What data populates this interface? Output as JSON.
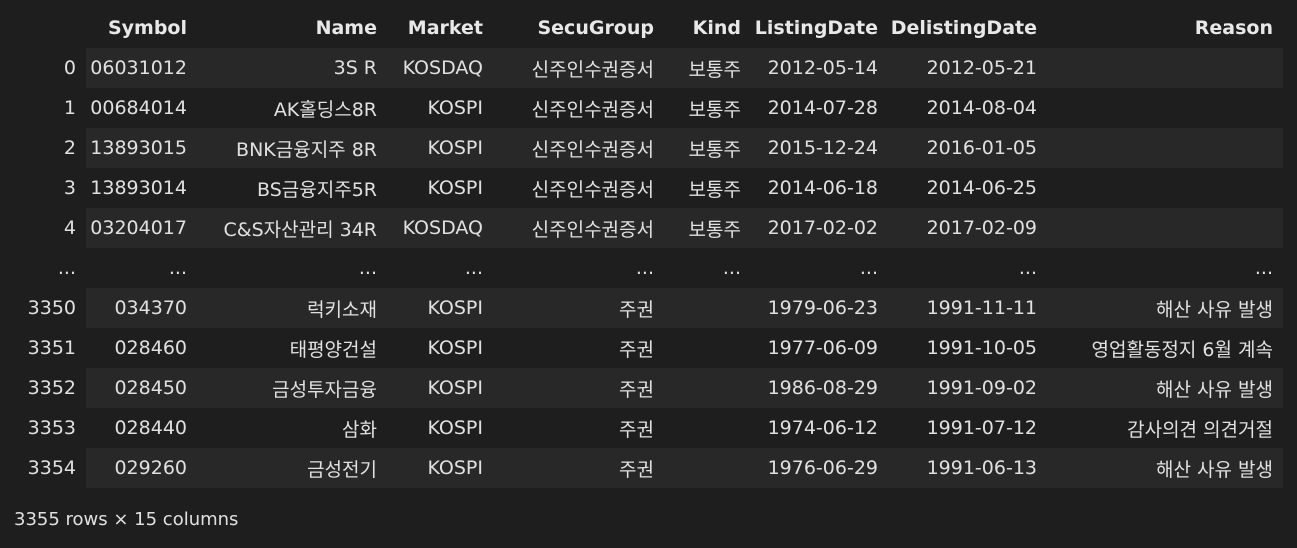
{
  "table": {
    "columns": [
      "",
      "Symbol",
      "Name",
      "Market",
      "SecuGroup",
      "Kind",
      "ListingDate",
      "DelistingDate",
      "Reason"
    ],
    "rows": [
      [
        "0",
        "06031012",
        "3S R",
        "KOSDAQ",
        "신주인수권증서",
        "보통주",
        "2012-05-14",
        "2012-05-21",
        ""
      ],
      [
        "1",
        "00684014",
        "AK홀딩스8R",
        "KOSPI",
        "신주인수권증서",
        "보통주",
        "2014-07-28",
        "2014-08-04",
        ""
      ],
      [
        "2",
        "13893015",
        "BNK금융지주 8R",
        "KOSPI",
        "신주인수권증서",
        "보통주",
        "2015-12-24",
        "2016-01-05",
        ""
      ],
      [
        "3",
        "13893014",
        "BS금융지주5R",
        "KOSPI",
        "신주인수권증서",
        "보통주",
        "2014-06-18",
        "2014-06-25",
        ""
      ],
      [
        "4",
        "03204017",
        "C&S자산관리 34R",
        "KOSDAQ",
        "신주인수권증서",
        "보통주",
        "2017-02-02",
        "2017-02-09",
        ""
      ],
      [
        "...",
        "...",
        "...",
        "...",
        "...",
        "...",
        "...",
        "...",
        "..."
      ],
      [
        "3350",
        "034370",
        "럭키소재",
        "KOSPI",
        "주권",
        "",
        "1979-06-23",
        "1991-11-11",
        "해산 사유 발생"
      ],
      [
        "3351",
        "028460",
        "태평양건설",
        "KOSPI",
        "주권",
        "",
        "1977-06-09",
        "1991-10-05",
        "영업활동정지 6월 계속"
      ],
      [
        "3352",
        "028450",
        "금성투자금융",
        "KOSPI",
        "주권",
        "",
        "1986-08-29",
        "1991-09-02",
        "해산 사유 발생"
      ],
      [
        "3353",
        "028440",
        "삼화",
        "KOSPI",
        "주권",
        "",
        "1974-06-12",
        "1991-07-12",
        "감사의견 의견거절"
      ],
      [
        "3354",
        "029260",
        "금성전기",
        "KOSPI",
        "주권",
        "",
        "1976-06-29",
        "1991-06-13",
        "해산 사유 발생"
      ]
    ]
  },
  "footer": {
    "shape": "3355 rows × 15 columns"
  }
}
